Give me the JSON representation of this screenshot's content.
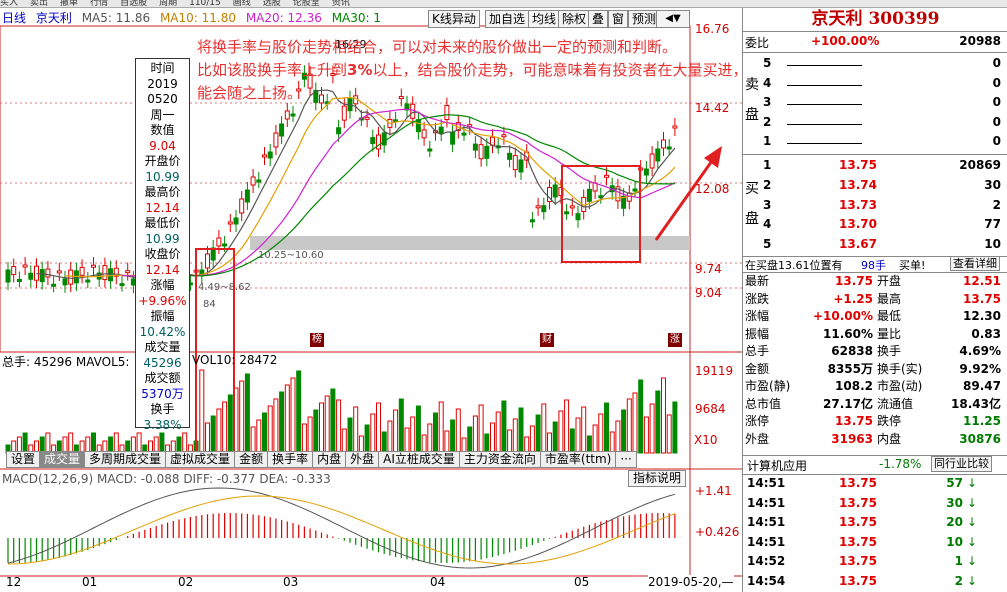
{
  "topbar": [
    "买入",
    "卖出",
    "撤单",
    "行情",
    "自选股",
    "周期",
    "110/15",
    "画线",
    "选股",
    "论股堂",
    "资讯"
  ],
  "stock": {
    "name": "京天利",
    "code": "300399",
    "title": "京天利 300399"
  },
  "legend": {
    "period": "日线",
    "name": "京天利",
    "ma5": "MA5: 11.86",
    "ma10": "MA10: 11.80",
    "ma20": "MA20: 12.36",
    "ma30": "MA30: 1"
  },
  "toolbar": [
    "K线异动",
    "加自选",
    "均线",
    "除权",
    "叠",
    "窗",
    "预测"
  ],
  "price_labels": [
    "16.76",
    "14.42",
    "12.08",
    "9.74",
    "9.04"
  ],
  "chart_marks": {
    "high": "16.29",
    "band": "10.25~10.60",
    "low": "4.49~8.62",
    "mark_a": "84"
  },
  "events": {
    "bang": "榜",
    "cai": "财",
    "zhang": "涨"
  },
  "infobox": {
    "rows": [
      {
        "label": "时间",
        "cls": ""
      },
      {
        "label": "2019",
        "cls": ""
      },
      {
        "label": "0520",
        "cls": ""
      },
      {
        "label": "周一",
        "cls": ""
      },
      {
        "label": "数值",
        "cls": ""
      },
      {
        "label": "9.04",
        "cls": "red"
      },
      {
        "label": "开盘价",
        "cls": ""
      },
      {
        "label": "10.99",
        "cls": "teal"
      },
      {
        "label": "最高价",
        "cls": ""
      },
      {
        "label": "12.14",
        "cls": "red"
      },
      {
        "label": "最低价",
        "cls": ""
      },
      {
        "label": "10.99",
        "cls": "teal"
      },
      {
        "label": "收盘价",
        "cls": ""
      },
      {
        "label": "12.14",
        "cls": "red"
      },
      {
        "label": "涨幅",
        "cls": ""
      },
      {
        "label": "+9.96%",
        "cls": "red"
      },
      {
        "label": "振幅",
        "cls": ""
      },
      {
        "label": "10.42%",
        "cls": "teal"
      },
      {
        "label": "成交量",
        "cls": ""
      },
      {
        "label": "45296",
        "cls": "teal"
      },
      {
        "label": "成交额",
        "cls": ""
      },
      {
        "label": "5370万",
        "cls": "blue"
      },
      {
        "label": "换手",
        "cls": ""
      },
      {
        "label": "3.38%",
        "cls": "teal"
      }
    ]
  },
  "annotation": {
    "line1": "将换手率与股价走势相结合，可以对未来的股价做出一定的预测和判断。",
    "line2_a": "比如该股换手率上升到",
    "line2_b": "3%",
    "line2_c": "以上，结合股价走势，可能意味着有投资者在大量买进，股价可能会随之上扬。"
  },
  "volume": {
    "legend_a": "总手: 45296",
    "legend_b": "MAVOL5:",
    "legend_c": "VOL10: 28472",
    "labels": [
      "19119",
      "9684",
      "X10"
    ]
  },
  "tabs": [
    "设置",
    "成交量",
    "多周期成交量",
    "虚拟成交量",
    "金额",
    "换手率",
    "内盘",
    "外盘",
    "AI立桩成交量",
    "主力资金流向",
    "市盈率(ttm)",
    "···"
  ],
  "macd": {
    "title": "MACD(12,26,9)",
    "macd": "MACD: -0.088",
    "diff": "DIFF: -0.377",
    "dea": "DEA: -0.333",
    "btn": "指标说明",
    "labels": [
      "+1.41",
      "+0.426"
    ]
  },
  "xaxis": [
    "12",
    "01",
    "02",
    "03",
    "04",
    "05"
  ],
  "date_label": "2019-05-20,—",
  "side": {
    "weibi_label": "委比",
    "weibi": "+100.00%",
    "weicha": "20988",
    "sell_label": "卖盘",
    "buy_label": "买盘",
    "sells": [
      {
        "n": "5",
        "p": "",
        "v": "0"
      },
      {
        "n": "4",
        "p": "",
        "v": "0"
      },
      {
        "n": "3",
        "p": "",
        "v": "0"
      },
      {
        "n": "2",
        "p": "",
        "v": "0"
      },
      {
        "n": "1",
        "p": "",
        "v": "0"
      }
    ],
    "buys": [
      {
        "n": "1",
        "p": "13.75",
        "v": "20869"
      },
      {
        "n": "2",
        "p": "13.74",
        "v": "30"
      },
      {
        "n": "3",
        "p": "13.73",
        "v": "2"
      },
      {
        "n": "4",
        "p": "13.70",
        "v": "77"
      },
      {
        "n": "5",
        "p": "13.67",
        "v": "10"
      }
    ],
    "status": "在买盘13.61位置有",
    "status_v": "98手",
    "status_b": "买单!",
    "detail_btn": "查看详细",
    "stats": [
      [
        "最新",
        "13.75",
        "开盘",
        "12.51"
      ],
      [
        "涨跌",
        "+1.25",
        "最高",
        "13.75"
      ],
      [
        "涨幅",
        "+10.00%",
        "最低",
        "12.30"
      ],
      [
        "振幅",
        "11.60%",
        "量比",
        "0.83"
      ],
      [
        "总手",
        "62838",
        "换手",
        "4.69%"
      ],
      [
        "金额",
        "8355万",
        "换手(实)",
        "9.92%"
      ],
      [
        "市盈(静)",
        "108.2",
        "市盈(动)",
        "89.47"
      ],
      [
        "总市值",
        "27.17亿",
        "流通值",
        "18.43亿"
      ],
      [
        "涨停",
        "13.75",
        "跌停",
        "11.25"
      ],
      [
        "外盘",
        "31963",
        "内盘",
        "30876"
      ]
    ],
    "industry_label": "计算机应用",
    "industry_chg": "-1.78%",
    "industry_btn": "同行业比较",
    "ticks": [
      [
        "14:51",
        "13.75",
        "57"
      ],
      [
        "14:51",
        "13.75",
        "30"
      ],
      [
        "14:51",
        "13.75",
        "20"
      ],
      [
        "14:51",
        "13.75",
        "10"
      ],
      [
        "14:52",
        "13.75",
        "1"
      ],
      [
        "14:54",
        "13.75",
        "2"
      ]
    ]
  },
  "colors": {
    "up": "#e00000",
    "down": "#008800",
    "ma5": "#555555",
    "ma10": "#e0a000",
    "ma20": "#d020d0",
    "ma30": "#008800"
  }
}
